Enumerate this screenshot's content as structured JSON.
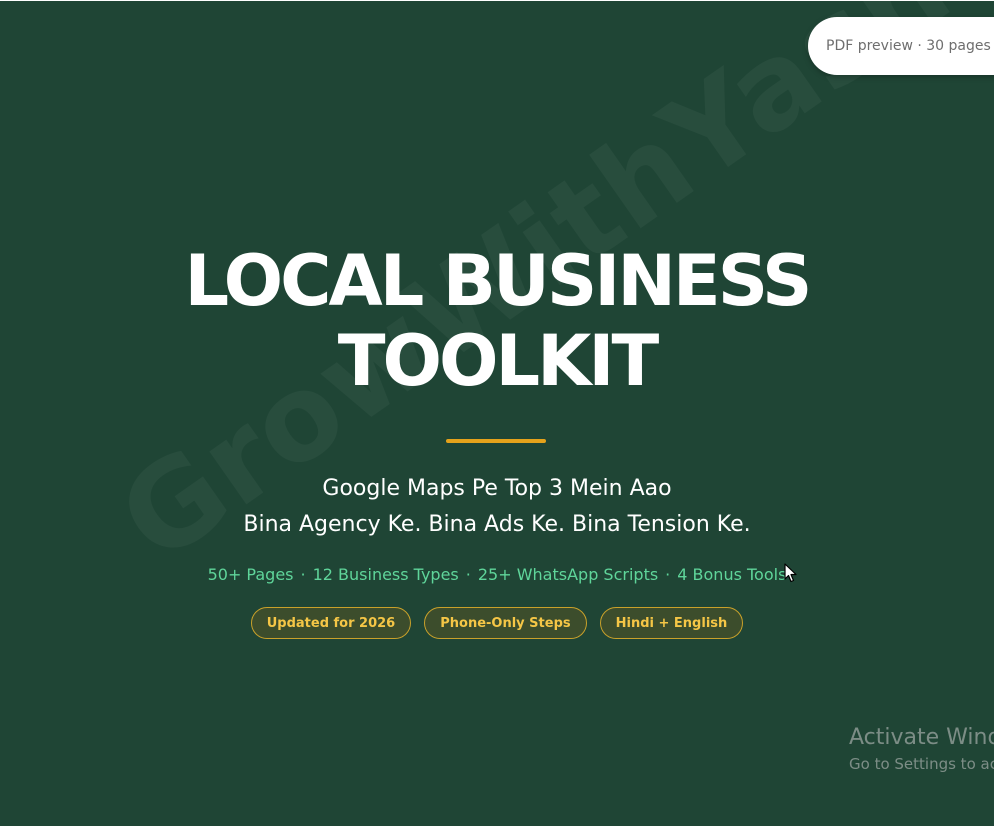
{
  "preview_badge": "PDF preview · 30 pages",
  "watermark": "GrowWithYash.com",
  "title": {
    "line1": "LOCAL BUSINESS",
    "line2": "TOOLKIT"
  },
  "subtitle": {
    "line1": "Google Maps Pe Top 3 Mein Aao",
    "line2": "Bina Agency Ke. Bina Ads Ke. Bina Tension Ke."
  },
  "stats": [
    "50+ Pages",
    "12 Business Types",
    "25+ WhatsApp Scripts",
    "4 Bonus Tools"
  ],
  "stats_separator": "·",
  "badges": [
    "Updated for 2026",
    "Phone-Only Steps",
    "Hindi + English"
  ],
  "windows_notice": {
    "title": "Activate Windows",
    "subtitle": "Go to Settings to activate Windows."
  },
  "colors": {
    "background": "#1f4535",
    "accent": "#e5a21b",
    "stats_text": "#5fd59a",
    "badge_text": "#f5c646"
  },
  "icons": [
    "mouse-cursor-icon"
  ]
}
